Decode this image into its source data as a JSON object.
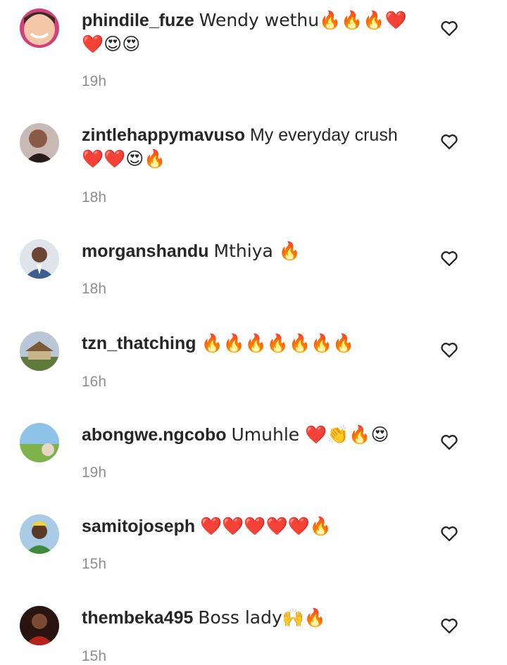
{
  "comments": [
    {
      "username": "phindile_fuze",
      "text": "Wendy wethu🔥🔥🔥❤️",
      "continuation": "❤️😍😍",
      "time": "19h",
      "avatar_icon": "avatar-woman-smiling"
    },
    {
      "username": "zintlehappymavuso",
      "text": "My everyday crush",
      "continuation": "❤️❤️😍🔥",
      "time": "18h",
      "avatar_icon": "avatar-woman-selfie"
    },
    {
      "username": "morganshandu",
      "text": "Mthiya 🔥",
      "continuation": "",
      "time": "18h",
      "avatar_icon": "avatar-man-suit"
    },
    {
      "username": "tzn_thatching",
      "text": "🔥🔥🔥🔥🔥🔥🔥",
      "continuation": "",
      "time": "16h",
      "avatar_icon": "avatar-thatched-house"
    },
    {
      "username": "abongwe.ngcobo",
      "text": "Umuhle ❤️👏🔥😍",
      "continuation": "",
      "time": "19h",
      "avatar_icon": "avatar-landscape"
    },
    {
      "username": "samitojoseph",
      "text": "❤️❤️❤️❤️❤️🔥",
      "continuation": "",
      "time": "15h",
      "avatar_icon": "avatar-man-cap"
    },
    {
      "username": "thembeka495",
      "text": "Boss lady🙌🔥",
      "continuation": "",
      "time": "15h",
      "avatar_icon": "avatar-woman-red"
    }
  ],
  "like_icon": "heart-outline-icon",
  "colors": {
    "text": "#262626",
    "timestamp": "#8e8e8e",
    "background": "#ffffff"
  }
}
